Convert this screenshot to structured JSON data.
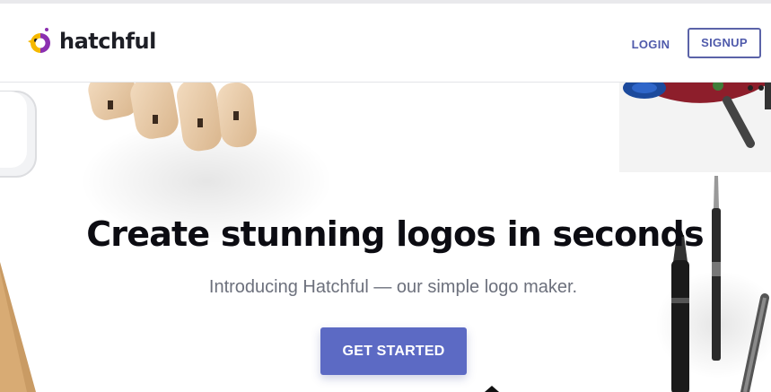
{
  "brand": {
    "name": "hatchful",
    "logo_icon": "hatchful-bird-icon",
    "colors": {
      "yellow": "#f5b800",
      "purple": "#8b2fb0",
      "dark": "#1e1f26"
    }
  },
  "nav": {
    "login_label": "LOGIN",
    "signup_label": "SIGNUP",
    "link_color": "#4f5aab"
  },
  "hero": {
    "title": "Create stunning logos in seconds",
    "subtitle": "Introducing Hatchful — our simple logo maker.",
    "cta_label": "GET STARTED",
    "cta_color": "#5c6ac4",
    "decorations": [
      "wooden-hand-image",
      "tablet-corner-image",
      "pens-image",
      "tape-dispenser-image",
      "notebook-corner-image"
    ]
  }
}
